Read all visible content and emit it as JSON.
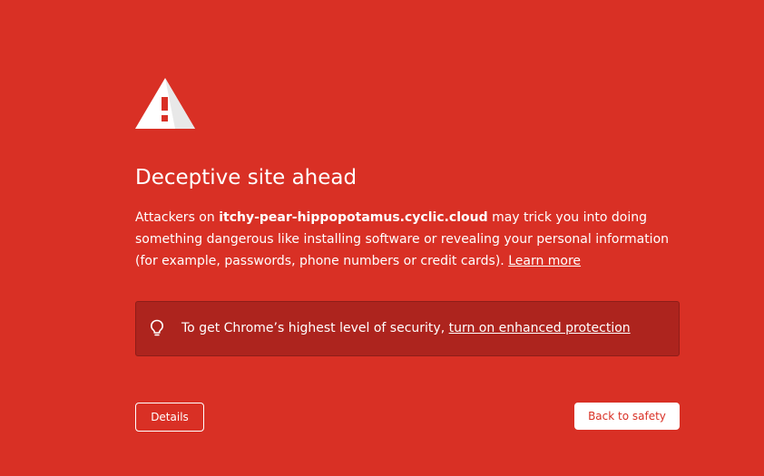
{
  "page": {
    "title": "Deceptive site ahead",
    "icon": "warning-triangle-icon",
    "background_color": "#d93025"
  },
  "message": {
    "prefix": "Attackers on ",
    "domain": "itchy-pear-hippopotamus.cyclic.cloud",
    "suffix": " may trick you into doing something dangerous like installing software or revealing your personal information (for example, passwords, phone numbers or credit cards). ",
    "learn_more": "Learn more"
  },
  "enhanced_protection": {
    "icon": "lightbulb-icon",
    "text": "To get Chrome’s highest level of security, ",
    "link": "turn on enhanced protection",
    "background_color": "#ad241e"
  },
  "buttons": {
    "details": "Details",
    "back_to_safety": "Back to safety"
  }
}
